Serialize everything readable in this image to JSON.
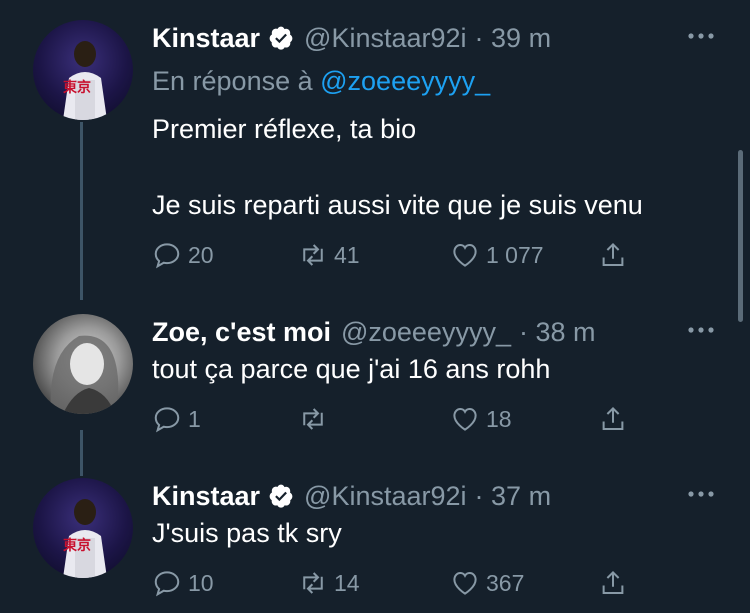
{
  "tweets": [
    {
      "name": "Kinstaar",
      "handle": "@Kinstaar92i",
      "time": "· 39 m",
      "verified": true,
      "reply_prefix": "En réponse à ",
      "reply_mention": "@zoeeeyyyy_",
      "text": "Premier réflexe, ta bio\n\nJe suis reparti aussi vite que je suis venu",
      "replies": "20",
      "retweets": "41",
      "likes": "1 077",
      "avatar_text": "東京"
    },
    {
      "name": "Zoe, c'est moi",
      "handle": "@zoeeeyyyy_",
      "time": "· 38 m",
      "verified": false,
      "text": "tout ça parce que j'ai 16 ans rohh",
      "replies": "1",
      "retweets": "",
      "likes": "18"
    },
    {
      "name": "Kinstaar",
      "handle": "@Kinstaar92i",
      "time": "· 37 m",
      "verified": true,
      "text": "J'suis pas tk sry",
      "replies": "10",
      "retweets": "14",
      "likes": "367",
      "avatar_text": "東京"
    }
  ],
  "colors": {
    "background": "#15202b",
    "secondary_text": "#8899a6",
    "link": "#1da1f2",
    "thread_line": "#3d5466"
  },
  "icons": [
    "verified-badge-icon",
    "more-icon",
    "reply-icon",
    "retweet-icon",
    "like-icon",
    "share-icon"
  ]
}
